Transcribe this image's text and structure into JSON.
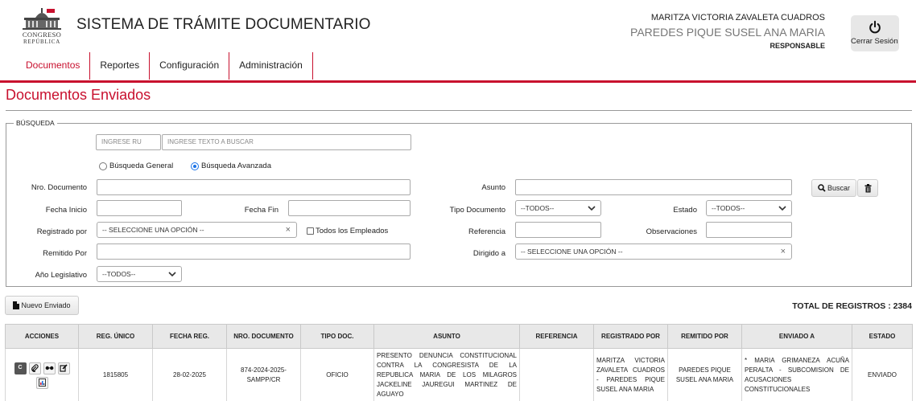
{
  "header": {
    "logo_line1": "CONGRESO",
    "logo_line2": "REPÚBLICA",
    "title": "SISTEMA DE TRÁMITE DOCUMENTARIO",
    "user_name": "MARITZA VICTORIA ZAVALETA CUADROS",
    "user_sub": "PAREDES PIQUE SUSEL ANA MARIA",
    "user_role": "RESPONSABLE",
    "logout_label": "Cerrar Sesión"
  },
  "nav": [
    {
      "label": "Documentos"
    },
    {
      "label": "Reportes"
    },
    {
      "label": "Configuración"
    },
    {
      "label": "Administración"
    }
  ],
  "page_title": "Documentos Enviados",
  "search": {
    "legend": "BÚSQUEDA",
    "ru_placeholder": "INGRESE RU",
    "text_placeholder": "INGRESE TEXTO A BUSCAR",
    "radio_general": "Búsqueda General",
    "radio_advanced": "Búsqueda Avanzada",
    "labels": {
      "nro_documento": "Nro. Documento",
      "fecha_inicio": "Fecha Inicio",
      "fecha_fin": "Fecha Fin",
      "registrado_por": "Registrado por",
      "remitido_por": "Remitido Por",
      "anio_legislativo": "Año Legislativo",
      "asunto": "Asunto",
      "tipo_documento": "Tipo Documento",
      "estado": "Estado",
      "referencia": "Referencia",
      "observaciones": "Observaciones",
      "dirigido_a": "Dirigido a"
    },
    "select_option_placeholder": "-- SELECCIONE UNA OPCIÓN --",
    "todos": "--TODOS--",
    "todos_empleados": "Todos los Empleados",
    "buscar_label": "Buscar"
  },
  "toolbar": {
    "nuevo_label": "Nuevo Enviado",
    "total_label": "TOTAL DE REGISTROS : 2384"
  },
  "table": {
    "headers": [
      "ACCIONES",
      "REG. ÚNICO",
      "FECHA REG.",
      "NRO. DOCUMENTO",
      "TIPO DOC.",
      "ASUNTO",
      "REFERENCIA",
      "REGISTRADO POR",
      "REMITIDO POR",
      "ENVIADO A",
      "ESTADO"
    ],
    "rows": [
      {
        "reg_unico": "1815805",
        "fecha": "28-02-2025",
        "nro_documento": "874-2024-2025-SAMPP/CR",
        "tipo": "OFICIO",
        "asunto": "PRESENTO DENUNCIA CONSTITUCIONAL CONTRA LA CONGRESISTA DE LA REPUBLICA MARIA DE LOS MILAGROS JACKELINE JAUREGUI MARTINEZ DE AGUAYO",
        "referencia": "",
        "registrado_por": "MARITZA VICTORIA ZAVALETA CUADROS - PAREDES PIQUE SUSEL ANA MARIA",
        "remitido_por": "PAREDES PIQUE SUSEL ANA MARIA",
        "enviado_a": "* MARIA GRIMANEZA ACUÑA PERALTA - SUBCOMISION DE ACUSACIONES CONSTITUCIONALES",
        "estado": "ENVIADO"
      }
    ]
  }
}
